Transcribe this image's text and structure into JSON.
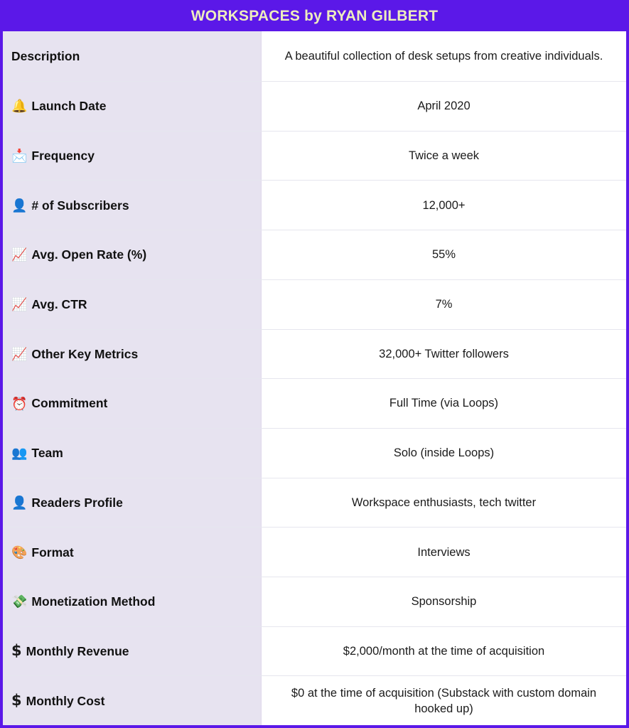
{
  "header": {
    "title": "WORKSPACES by RYAN GILBERT",
    "background_color": "#5B18E8",
    "text_color": "#EDEDBE"
  },
  "theme": {
    "accent_purple": "#5B18E8",
    "label_column_bg": "#E7E3F0",
    "value_column_bg": "#FFFFFF",
    "row_divider": "#E6E6EE",
    "text_color": "#111111"
  },
  "table": {
    "rows": [
      {
        "icon": "",
        "icon_name": "none",
        "label": "Description",
        "value": "A beautiful collection of desk setups from creative individuals.",
        "size": "tall"
      },
      {
        "icon": "🔔",
        "icon_name": "bell-icon",
        "label": "Launch Date",
        "value": "April 2020",
        "size": "normal"
      },
      {
        "icon": "📩",
        "icon_name": "envelope-with-arrow-icon",
        "label": "Frequency",
        "value": "Twice a week",
        "size": "normal"
      },
      {
        "icon": "👤",
        "icon_name": "bust-in-silhouette-icon",
        "label": "# of Subscribers",
        "value": "12,000+",
        "size": "normal"
      },
      {
        "icon": "📈",
        "icon_name": "chart-increasing-icon",
        "label": "Avg. Open Rate (%)",
        "value": "55%",
        "size": "normal"
      },
      {
        "icon": "📈",
        "icon_name": "chart-increasing-icon",
        "label": "Avg. CTR",
        "value": "7%",
        "size": "normal"
      },
      {
        "icon": "📈",
        "icon_name": "chart-increasing-icon",
        "label": "Other Key Metrics",
        "value": "32,000+ Twitter followers",
        "size": "normal"
      },
      {
        "icon": "⏰",
        "icon_name": "alarm-clock-icon",
        "label": "Commitment",
        "value": "Full Time (via Loops)",
        "size": "normal"
      },
      {
        "icon": "👥",
        "icon_name": "busts-in-silhouette-icon",
        "label": "Team",
        "value": "Solo (inside Loops)",
        "size": "normal"
      },
      {
        "icon": "👤",
        "icon_name": "bust-in-silhouette-icon",
        "label": "Readers Profile",
        "value": "Workspace enthusiasts, tech twitter",
        "size": "normal"
      },
      {
        "icon": "🎨",
        "icon_name": "artist-palette-icon",
        "label": "Format",
        "value": "Interviews",
        "size": "normal"
      },
      {
        "icon": "💸",
        "icon_name": "money-with-wings-icon",
        "label": "Monetization Method",
        "value": "Sponsorship",
        "size": "normal"
      },
      {
        "icon": "$",
        "icon_name": "heavy-dollar-sign-icon",
        "label": "Monthly Revenue",
        "value": "$2,000/month at the time of acquisition",
        "size": "normal"
      },
      {
        "icon": "$",
        "icon_name": "heavy-dollar-sign-icon",
        "label": "Monthly Cost",
        "value": "$0 at the time of acquisition (Substack with custom domain hooked up)",
        "size": "normal"
      }
    ]
  }
}
